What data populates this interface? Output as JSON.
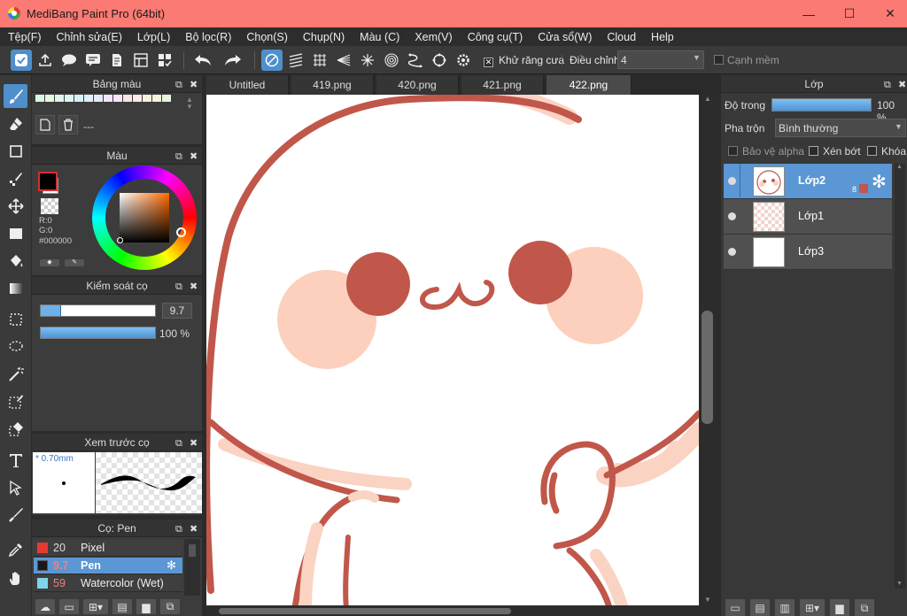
{
  "window": {
    "title": "MediBang Paint Pro (64bit)",
    "min_glyph": "—",
    "max_glyph": "☐",
    "close_glyph": "✕"
  },
  "menu": [
    "Tệp(F)",
    "Chỉnh sửa(E)",
    "Lớp(L)",
    "Bộ lọc(R)",
    "Chọn(S)",
    "Chụp(N)",
    "Màu (C)",
    "Xem(V)",
    "Công cụ(T)",
    "Cửa sổ(W)",
    "Cloud",
    "Help"
  ],
  "toolbar": {
    "antialias_label": "Khử răng cưa",
    "antialias_checked": true,
    "correction_label": "Điều chỉnh",
    "correction_value": "4",
    "soft_edge_label": "Cạnh mềm",
    "soft_edge_checked": false,
    "icons": [
      "send-icon",
      "upload-icon",
      "speech-bubble-icon",
      "chat-icon",
      "document-icon",
      "panel-icon",
      "grid-icon",
      "undo-icon",
      "redo-icon",
      "snap-off-icon",
      "parallel-ruler-icon",
      "grid-ruler-icon",
      "perspective-ruler-icon",
      "radial-ruler-icon",
      "concentric-ruler-icon",
      "curve-ruler-icon",
      "ellipse-ruler-icon",
      "settings-icon"
    ]
  },
  "palette_panel": {
    "title": "Bảng màu",
    "status": "---",
    "swatches": [
      "#dff5e3",
      "#e4f7e6",
      "#e1f3ec",
      "#ddf6f2",
      "#d7f2f6",
      "#e0f0fb",
      "#e6e9fb",
      "#efe8fb",
      "#f7e6f5",
      "#fbe5ea",
      "#fbece4",
      "#f8f1dc",
      "#f3f4dc",
      "#eaf5dc"
    ]
  },
  "color_panel": {
    "title": "Màu",
    "r": "R:0",
    "g": "G:0",
    "hex": "#000000",
    "fg_color": "#000000",
    "bg_color": "#ffffff"
  },
  "brush_control": {
    "title": "Kiểm soát cọ",
    "size_value": "9.7",
    "size_fraction": 0.18,
    "opacity_value": "100 %",
    "opacity_fraction": 1.0
  },
  "brush_preview": {
    "title": "Xem trước cọ",
    "size_label": "* 0.70mm"
  },
  "brush_list": {
    "title": "Cọ: Pen",
    "items": [
      {
        "size": "20",
        "name": "Pixel",
        "color": "#e53935",
        "selected": false
      },
      {
        "size": "9.7",
        "name": "Pen",
        "color": "#1a1a1a",
        "selected": true
      },
      {
        "size": "59",
        "name": "Watercolor (Wet)",
        "color": "#7fd3ea",
        "selected": false
      }
    ]
  },
  "tabs": [
    {
      "label": "Untitled",
      "active": false
    },
    {
      "label": "419.png",
      "active": false
    },
    {
      "label": "420.png",
      "active": false
    },
    {
      "label": "421.png",
      "active": false
    },
    {
      "label": "422.png",
      "active": true
    }
  ],
  "layer_panel": {
    "title": "Lớp",
    "opacity_label": "Độ trong",
    "opacity_value": "100 %",
    "blend_label": "Pha trộn",
    "blend_value": "Bình thường",
    "protect_alpha": "Bảo vệ alpha",
    "clipping": "Xén bớt",
    "lock": "Khóa",
    "layers": [
      {
        "name": "Lớp2",
        "badge": "8",
        "selected": true
      },
      {
        "name": "Lớp1",
        "badge": "",
        "selected": false
      },
      {
        "name": "Lớp3",
        "badge": "",
        "selected": false
      }
    ]
  },
  "colors": {
    "accent": "#5b97d4",
    "titlebar": "#fb7b74",
    "outline": "#c0574a",
    "blush": "#fdd0bd"
  }
}
